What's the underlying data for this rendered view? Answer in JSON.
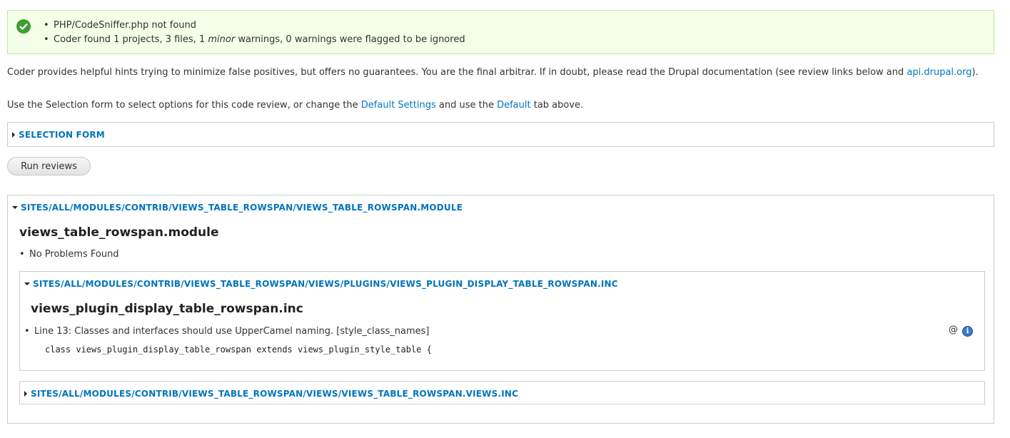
{
  "status": {
    "item1": "PHP/CodeSniffer.php not found",
    "item2_pre": "Coder found 1 projects, 3 files, 1 ",
    "item2_em": "minor",
    "item2_post": " warnings, 0 warnings were flagged to be ignored"
  },
  "intro": {
    "text": "Coder provides helpful hints trying to minimize false positives, but offers no guarantees. You are the final arbitrar. If in doubt, please read the Drupal documentation (see review links below and ",
    "link": "api.drupal.org",
    "end": ")."
  },
  "selection_para": {
    "pre": "Use the Selection form to select options for this code review, or change the ",
    "link1": "Default Settings",
    "mid": " and use the ",
    "link2": "Default",
    "post": " tab above."
  },
  "selection_form_legend": "SELECTION FORM",
  "run_button": "Run reviews",
  "module_review": {
    "legend": "SITES/ALL/MODULES/CONTRIB/VIEWS_TABLE_ROWSPAN/VIEWS_TABLE_ROWSPAN.MODULE",
    "title": "views_table_rowspan.module",
    "result": "No Problems Found"
  },
  "plugin_review": {
    "legend": "SITES/ALL/MODULES/CONTRIB/VIEWS_TABLE_ROWSPAN/VIEWS/PLUGINS/VIEWS_PLUGIN_DISPLAY_TABLE_ROWSPAN.INC",
    "title": "views_plugin_display_table_rowspan.inc",
    "warning": "Line 13: Classes and interfaces should use UpperCamel naming. [style_class_names]",
    "code": "class views_plugin_display_table_rowspan extends views_plugin_style_table {",
    "at_symbol": "@",
    "info_glyph": "i"
  },
  "views_inc_legend": "SITES/ALL/MODULES/CONTRIB/VIEWS_TABLE_ROWSPAN/VIEWS/VIEWS_TABLE_ROWSPAN.VIEWS.INC"
}
